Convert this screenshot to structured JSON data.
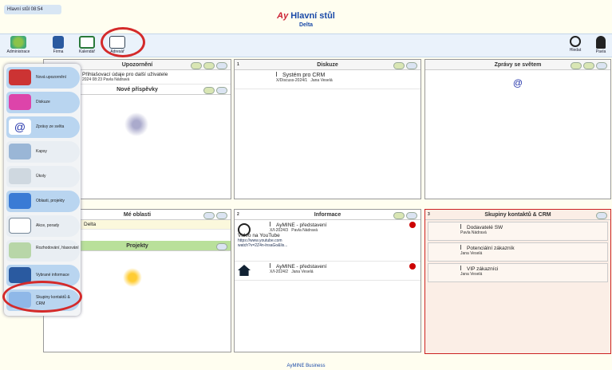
{
  "header": {
    "home_tab": "Hlavní stůl 08:54",
    "title": "Hlavní stůl",
    "subtitle": "Delta",
    "footer": "AyMINE Business"
  },
  "toolbar": {
    "items": [
      {
        "label": "Administrace"
      },
      {
        "label": "Firma"
      },
      {
        "label": "Kalendář"
      },
      {
        "label": "Adresář"
      }
    ],
    "search_label": "Hledat",
    "user_label": "Pavla"
  },
  "menu": {
    "items": [
      {
        "label": "Nová upozornění"
      },
      {
        "label": "Diskuze"
      },
      {
        "label": "Zprávy ze světa"
      },
      {
        "label": "Kapsy"
      },
      {
        "label": "Úkoly"
      },
      {
        "label": "Oblasti, projekty"
      },
      {
        "label": "Akce, porady"
      },
      {
        "label": "Rozhodování, hlasování"
      },
      {
        "label": "Vybrané informace"
      },
      {
        "label": "Skupiny kontaktů & CRM"
      }
    ]
  },
  "panels": {
    "upozorneni": {
      "title": "Upozornění",
      "row_text": "Přihlašovací údaje pro další uživatele",
      "row_meta": "2024 08:23 Pavla Nádravá",
      "sub_title": "Nové příspěvky"
    },
    "diskuze": {
      "title": "Diskuze",
      "num": "1",
      "row_title": "Systém pro CRM",
      "row_meta": "X/Discuss-2024/1",
      "row_user": "Jana Veselá"
    },
    "zpravy": {
      "title": "Zprávy se světem"
    },
    "oblasti": {
      "title": "Mé oblasti",
      "row": "Delta",
      "sub_title": "Projekty"
    },
    "informace": {
      "title": "Informace",
      "num": "2",
      "items": [
        {
          "title": "AyMINE - představení",
          "meta": "X/I-2024/3",
          "user": "Pavla Nádravá",
          "extra": "Video na YouTube",
          "link": "https://www.youtube.com",
          "link2": "watch?v=2Z4n-lnsaGo&lis..."
        },
        {
          "title": "AyMINE - představení",
          "meta": "X/I-2024/2",
          "user": "Jana Veselá"
        }
      ]
    },
    "skupiny": {
      "title": "Skupiny kontaktů & CRM",
      "num": "3",
      "items": [
        {
          "title": "Dodavatelé SW",
          "user": "Pavla Nádravá"
        },
        {
          "title": "Potenciální zákazník",
          "user": "Jana Veselá"
        },
        {
          "title": "VIP zákazníci",
          "user": "Jana Veselá"
        }
      ]
    }
  }
}
